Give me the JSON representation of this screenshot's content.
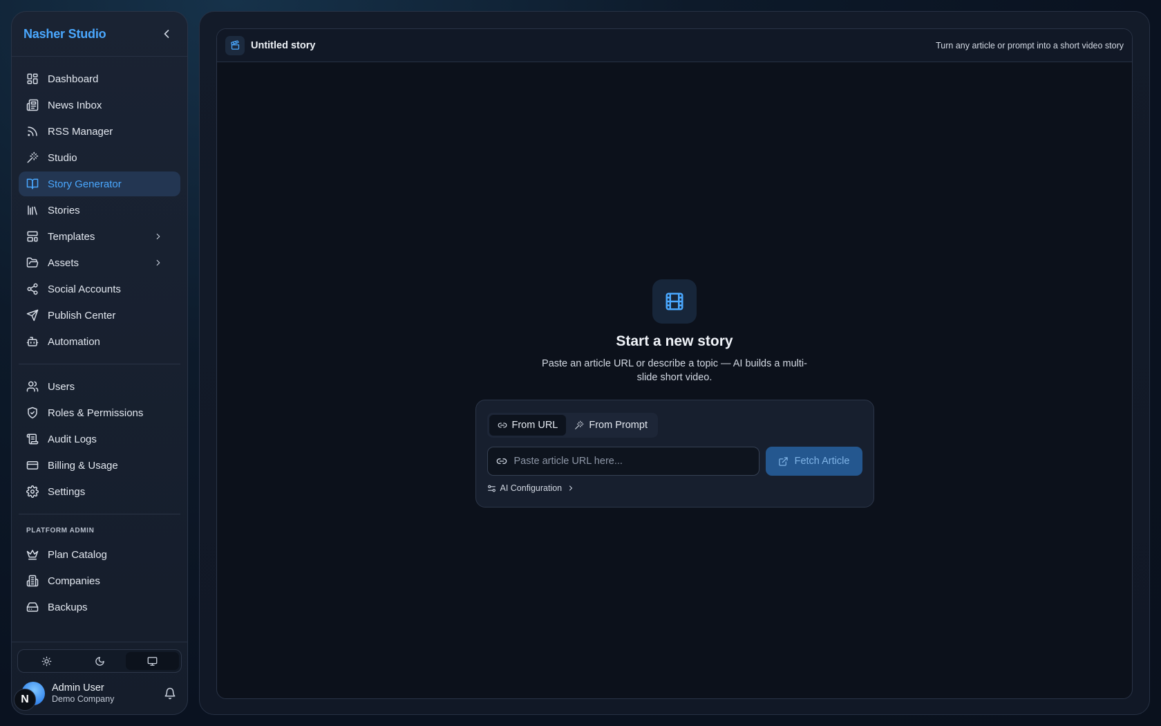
{
  "sidebar": {
    "brand": "Nasher Studio",
    "nav_main": [
      {
        "label": "Dashboard",
        "icon": "dashboard-icon"
      },
      {
        "label": "News Inbox",
        "icon": "newspaper-icon"
      },
      {
        "label": "RSS Manager",
        "icon": "rss-icon"
      },
      {
        "label": "Studio",
        "icon": "magic-wand-icon"
      },
      {
        "label": "Story Generator",
        "icon": "book-open-icon",
        "active": true
      },
      {
        "label": "Stories",
        "icon": "library-icon"
      },
      {
        "label": "Templates",
        "icon": "template-icon",
        "has_submenu": true
      },
      {
        "label": "Assets",
        "icon": "folder-open-icon",
        "has_submenu": true
      },
      {
        "label": "Social Accounts",
        "icon": "share-icon"
      },
      {
        "label": "Publish Center",
        "icon": "send-icon"
      },
      {
        "label": "Automation",
        "icon": "bot-icon"
      }
    ],
    "nav_admin": [
      {
        "label": "Users",
        "icon": "users-icon"
      },
      {
        "label": "Roles & Permissions",
        "icon": "shield-check-icon"
      },
      {
        "label": "Audit Logs",
        "icon": "log-icon"
      },
      {
        "label": "Billing & Usage",
        "icon": "credit-card-icon"
      },
      {
        "label": "Settings",
        "icon": "gear-icon"
      }
    ],
    "platform_section_label": "PLATFORM ADMIN",
    "nav_platform": [
      {
        "label": "Plan Catalog",
        "icon": "crown-icon"
      },
      {
        "label": "Companies",
        "icon": "building-icon"
      },
      {
        "label": "Backups",
        "icon": "hard-drive-icon"
      }
    ],
    "theme_options": [
      "light",
      "dark",
      "system"
    ],
    "theme_selected": "system",
    "user": {
      "name": "Admin User",
      "company": "Demo Company",
      "badge_letter": "N"
    }
  },
  "header": {
    "title": "Untitled story",
    "tagline": "Turn any article or prompt into a short video story"
  },
  "empty_state": {
    "title": "Start a new story",
    "description": "Paste an article URL or describe a topic — AI builds a multi-slide short video."
  },
  "source_card": {
    "tabs": [
      {
        "label": "From URL",
        "icon": "link-icon",
        "active": true
      },
      {
        "label": "From Prompt",
        "icon": "magic-wand-icon",
        "active": false
      }
    ],
    "url_input": {
      "value": "",
      "placeholder": "Paste article URL here..."
    },
    "fetch_button": "Fetch Article",
    "ai_config_label": "AI Configuration"
  },
  "colors": {
    "accent": "#4aa8ff",
    "active_nav_bg": "#233652",
    "fetch_button_bg": "#24578f",
    "page_bg": "#0a1220"
  }
}
